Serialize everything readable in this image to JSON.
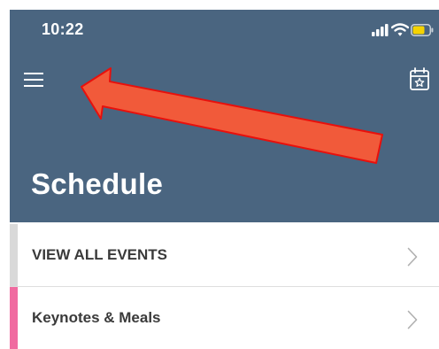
{
  "status_bar": {
    "time": "10:22",
    "icons": [
      "signal-icon",
      "wifi-icon",
      "battery-icon"
    ]
  },
  "header": {
    "menu_icon": "hamburger-menu-icon",
    "calendar_icon": "calendar-star-icon",
    "title": "Schedule",
    "background_color": "#4a6580"
  },
  "list": {
    "items": [
      {
        "label": "VIEW ALL EVENTS",
        "accent_color": "#d9d9d9",
        "chevron_icon": "chevron-right-icon"
      },
      {
        "label": "Keynotes & Meals",
        "accent_color": "#f06ba0",
        "chevron_icon": "chevron-right-icon"
      }
    ]
  },
  "annotation": {
    "type": "arrow",
    "color": "#f15a3a",
    "outline_color": "#e8100c",
    "target": "hamburger-menu-icon"
  }
}
